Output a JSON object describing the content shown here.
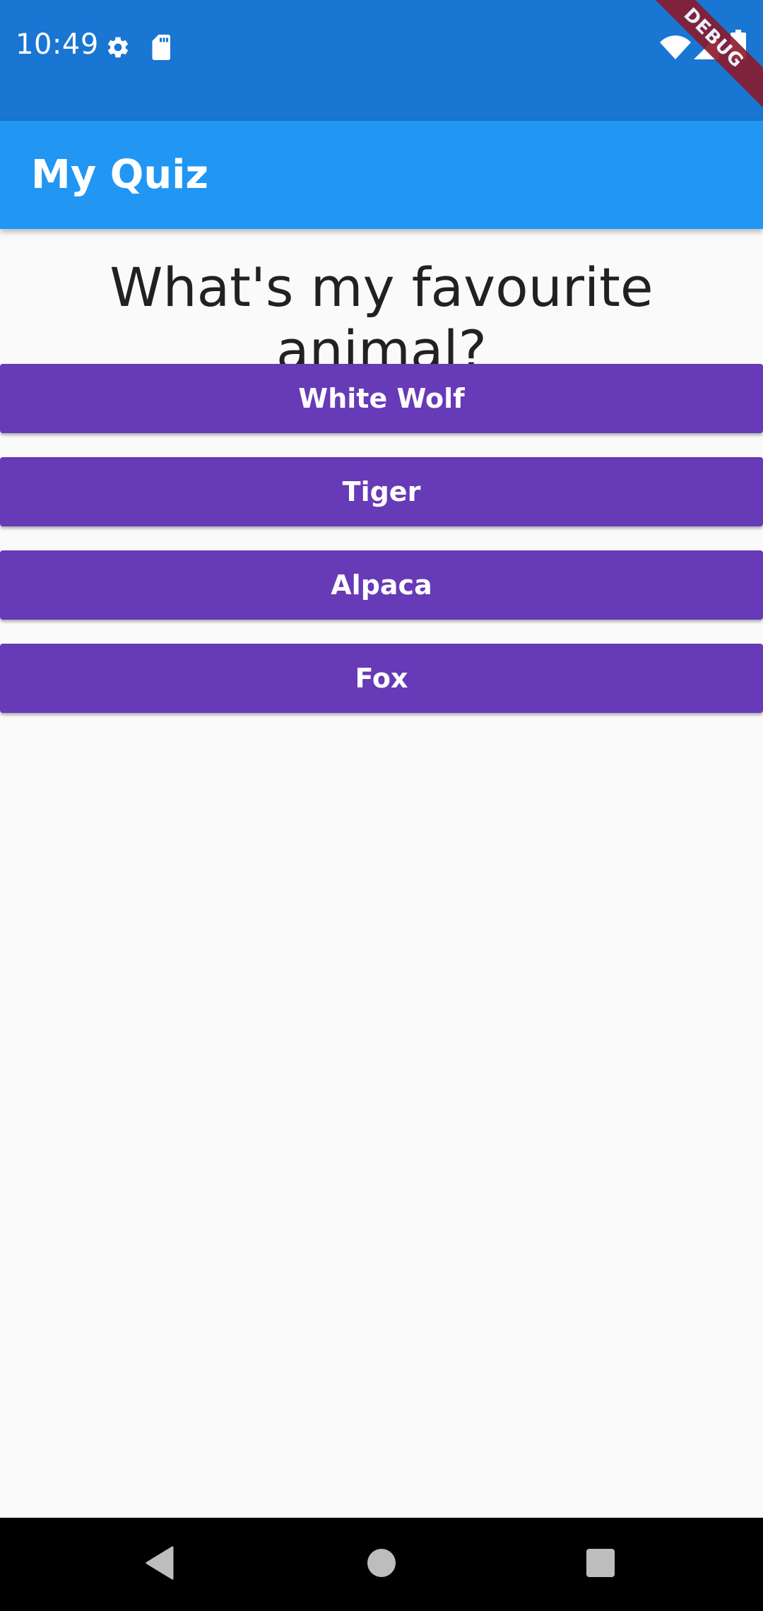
{
  "status_bar": {
    "time": "10:49",
    "icons": [
      "gear-icon",
      "sd-card-icon",
      "wifi-icon",
      "signal-icon",
      "battery-icon"
    ],
    "background": "#1976d2"
  },
  "debug_banner": {
    "label": "DEBUG"
  },
  "app_bar": {
    "title": "My Quiz",
    "background": "#2196f3"
  },
  "quiz": {
    "question": "What's my favourite animal?",
    "answers": [
      {
        "label": "White Wolf"
      },
      {
        "label": "Tiger"
      },
      {
        "label": "Alpaca"
      },
      {
        "label": "Fox"
      }
    ],
    "button_color": "#673ab7"
  },
  "nav_bar": {
    "buttons": [
      "back-icon",
      "home-icon",
      "recents-icon"
    ]
  }
}
